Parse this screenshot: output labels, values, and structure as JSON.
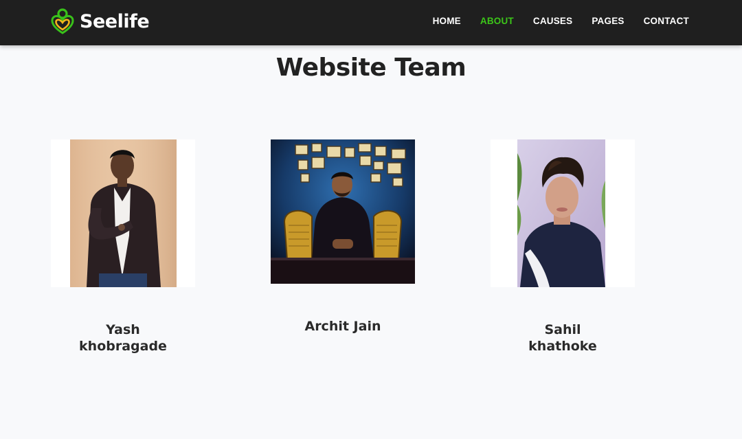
{
  "brand": {
    "name": "Seelife",
    "logo_icon": "heart-person-icon",
    "logo_colors": {
      "ring": "#39c11a",
      "heart": "#f3b51b"
    }
  },
  "nav": {
    "items": [
      {
        "label": "HOME",
        "active": false
      },
      {
        "label": "ABOUT",
        "active": true
      },
      {
        "label": "CAUSES",
        "active": false
      },
      {
        "label": "PAGES",
        "active": false
      },
      {
        "label": "CONTACT",
        "active": false
      }
    ],
    "active_color": "#3cc619"
  },
  "section": {
    "title": "Website Team"
  },
  "team": [
    {
      "name_line1": "Yash",
      "name_line2": "khobragade"
    },
    {
      "name_line1": "Archit Jain",
      "name_line2": ""
    },
    {
      "name_line1": "Sahil",
      "name_line2": "khathoke"
    }
  ]
}
